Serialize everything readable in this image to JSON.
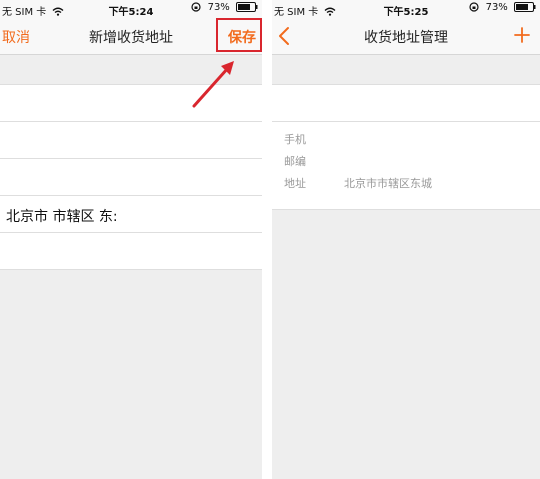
{
  "left_screen": {
    "status": {
      "carrier": "无 SIM 卡",
      "time": "下午5:24",
      "battery": "73%"
    },
    "nav": {
      "cancel_label": "取消",
      "title": "新增收货地址",
      "save_label": "保存"
    },
    "form": {
      "address_value": "北京市 市辖区 东:"
    }
  },
  "right_screen": {
    "status": {
      "carrier": "无 SIM 卡",
      "time": "下午5:25",
      "battery": "73%"
    },
    "nav": {
      "title": "收货地址管理"
    },
    "address_card": {
      "phone_label": "手机",
      "postcode_label": "邮编",
      "address_label": "地址",
      "address_value": "北京市市辖区东城"
    }
  },
  "colors": {
    "accent": "#f26b1d",
    "highlight": "#d9262e"
  },
  "icons": [
    "wifi-icon",
    "orientation-lock-icon",
    "battery-icon",
    "back-chevron-icon",
    "plus-icon",
    "red-arrow-icon"
  ]
}
